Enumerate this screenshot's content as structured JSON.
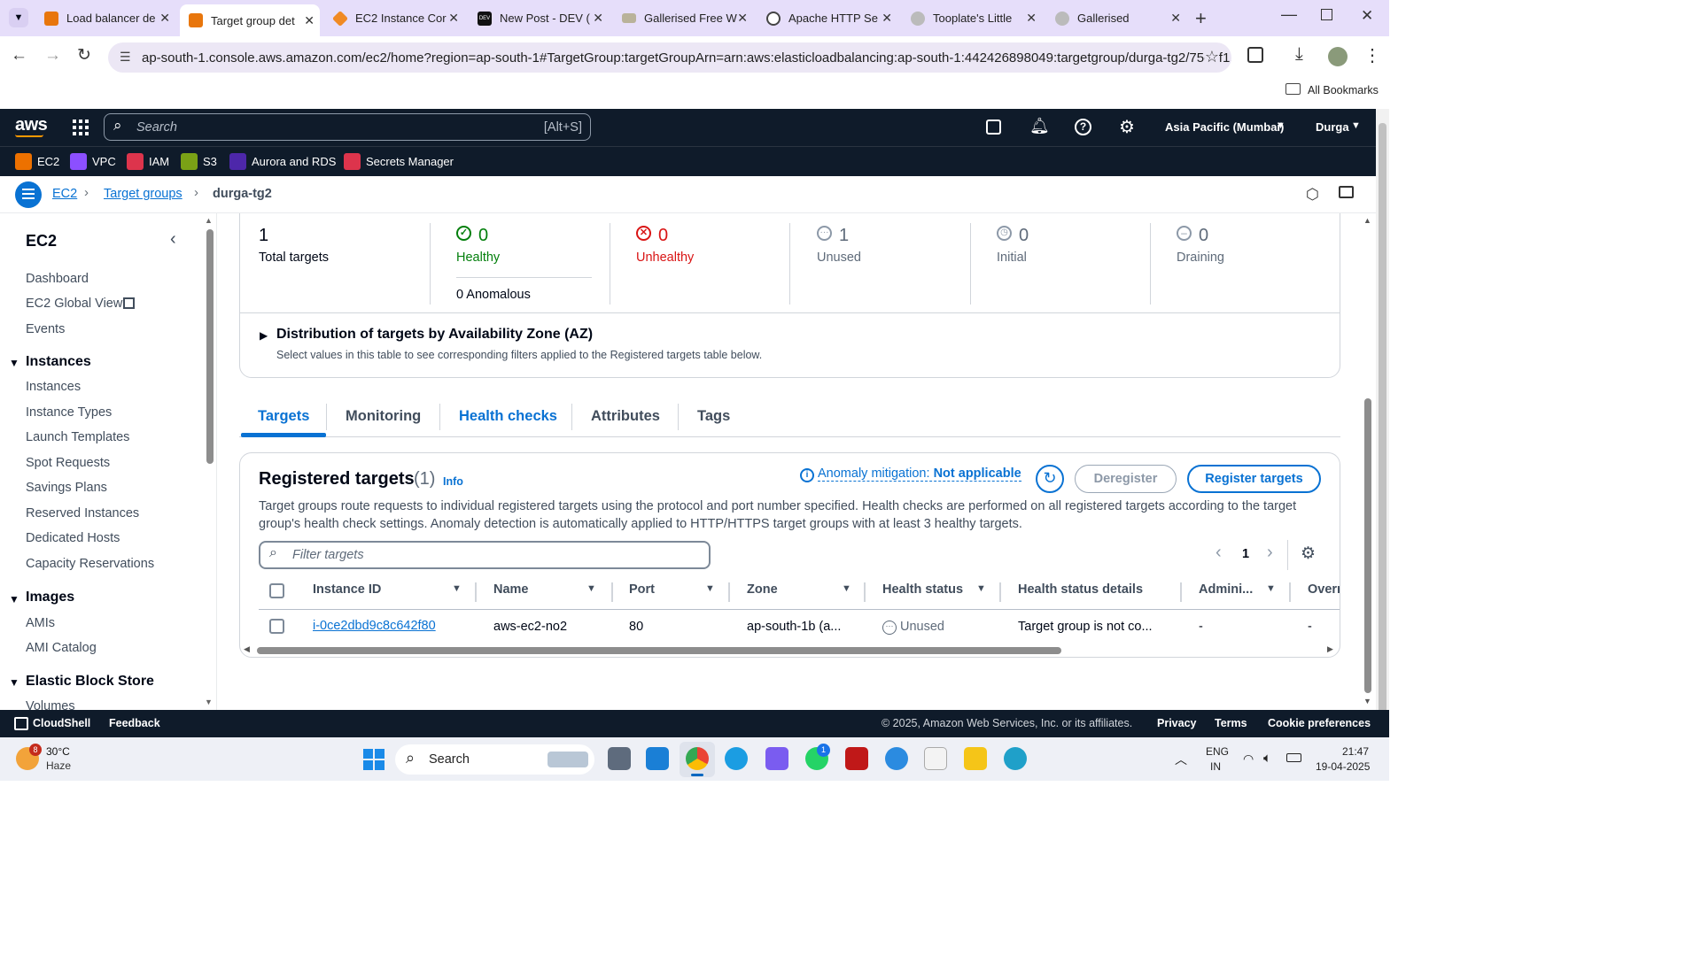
{
  "browser": {
    "tabs": [
      {
        "label": "Load balancer de",
        "color": "#e8760c"
      },
      {
        "label": "Target group det",
        "color": "#e8760c",
        "active": true
      },
      {
        "label": "EC2 Instance Cor",
        "color": "#f08a24"
      },
      {
        "label": "New Post - DEV (",
        "color": "#111"
      },
      {
        "label": "Gallerised Free W",
        "color": "#b9b29a"
      },
      {
        "label": "Apache HTTP Se",
        "color": "#444"
      },
      {
        "label": "Tooplate's Little",
        "color": "#888"
      },
      {
        "label": "Gallerised",
        "color": "#999"
      }
    ],
    "url": "ap-south-1.console.aws.amazon.com/ec2/home?region=ap-south-1#TargetGroup:targetGroupArn=arn:aws:elasticloadbalancing:ap-south-1:442426898049:targetgroup/durga-tg2/75e8f1...",
    "bookmarks_label": "All Bookmarks"
  },
  "aws": {
    "logo": "aws",
    "search_placeholder": "Search",
    "search_shortcut": "[Alt+S]",
    "region": "Asia Pacific (Mumbai)",
    "user": "Durga",
    "favorites": [
      "EC2",
      "VPC",
      "IAM",
      "S3",
      "Aurora and RDS",
      "Secrets Manager"
    ],
    "favorite_colors": [
      "#ed7100",
      "#8c4fff",
      "#dd344c",
      "#7aa116",
      "#4d27aa",
      "#dd344c"
    ]
  },
  "breadcrumb": {
    "ec2": "EC2",
    "target_groups": "Target groups",
    "current": "durga-tg2"
  },
  "sidebar": {
    "title": "EC2",
    "top_links": [
      "Dashboard",
      "EC2 Global View",
      "Events"
    ],
    "sections": [
      {
        "title": "Instances",
        "items": [
          "Instances",
          "Instance Types",
          "Launch Templates",
          "Spot Requests",
          "Savings Plans",
          "Reserved Instances",
          "Dedicated Hosts",
          "Capacity Reservations"
        ]
      },
      {
        "title": "Images",
        "items": [
          "AMIs",
          "AMI Catalog"
        ]
      },
      {
        "title": "Elastic Block Store",
        "items": [
          "Volumes"
        ]
      }
    ]
  },
  "summary": {
    "total": {
      "value": "1",
      "label": "Total targets"
    },
    "healthy": {
      "value": "0",
      "label": "Healthy"
    },
    "anomalous": "0 Anomalous",
    "unhealthy": {
      "value": "0",
      "label": "Unhealthy"
    },
    "unused": {
      "value": "1",
      "label": "Unused"
    },
    "initial": {
      "value": "0",
      "label": "Initial"
    },
    "draining": {
      "value": "0",
      "label": "Draining"
    },
    "az_title": "Distribution of targets by Availability Zone (AZ)",
    "az_desc": "Select values in this table to see corresponding filters applied to the Registered targets table below."
  },
  "tabs": [
    "Targets",
    "Monitoring",
    "Health checks",
    "Attributes",
    "Tags"
  ],
  "registered": {
    "title": "Registered targets",
    "count": "(1)",
    "info": "Info",
    "anomaly_label": "Anomaly mitigation:",
    "anomaly_value": "Not applicable",
    "deregister": "Deregister",
    "register": "Register targets",
    "description": "Target groups route requests to individual registered targets using the protocol and port number specified. Health checks are performed on all registered targets according to the target group's health check settings. Anomaly detection is automatically applied to HTTP/HTTPS target groups with at least 3 healthy targets.",
    "filter_placeholder": "Filter targets",
    "page": "1",
    "columns": [
      "Instance ID",
      "Name",
      "Port",
      "Zone",
      "Health status",
      "Health status details",
      "Admini...",
      "Overr"
    ],
    "rows": [
      {
        "instance_id": "i-0ce2dbd9c8c642f80",
        "name": "aws-ec2-no2",
        "port": "80",
        "zone": "ap-south-1b (a...",
        "health": "Unused",
        "details": "Target group is not co...",
        "admin": "-",
        "override": "-"
      }
    ]
  },
  "footer": {
    "cloudshell": "CloudShell",
    "feedback": "Feedback",
    "copyright": "© 2025, Amazon Web Services, Inc. or its affiliates.",
    "privacy": "Privacy",
    "terms": "Terms",
    "cookies": "Cookie preferences"
  },
  "taskbar": {
    "weather_temp": "30°C",
    "weather_desc": "Haze",
    "weather_badge": "8",
    "search": "Search",
    "lang1": "ENG",
    "lang2": "IN",
    "time": "21:47",
    "date": "19-04-2025",
    "whatsapp_badge": "1"
  }
}
